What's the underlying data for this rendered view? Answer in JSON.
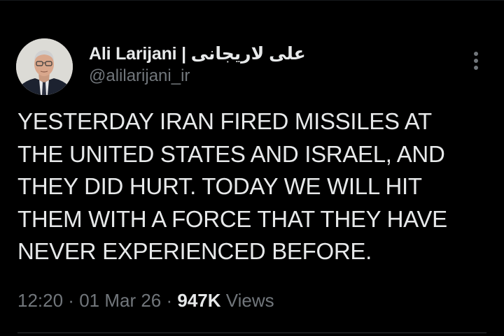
{
  "author": {
    "display_name": "Ali Larijani | علی لاریجانی",
    "handle": "@alilarijani_ir"
  },
  "tweet": {
    "lines": [
      "YESTERDAY IRAN FIRED MISSILES AT",
      "THE UNITED STATES AND ISRAEL, AND",
      "THEY DID HURT. TODAY WE WILL HIT",
      "THEM WITH A FORCE THAT THEY HAVE",
      "NEVER EXPERIENCED BEFORE."
    ]
  },
  "meta": {
    "time": "12:20",
    "separator": " · ",
    "date": "01 Mar 26",
    "views_count": "947K",
    "views_label": " Views"
  },
  "icons": {
    "more": "more-vertical-icon",
    "avatar": "profile-photo"
  },
  "colors": {
    "background": "#000000",
    "text_primary": "#e7e9ea",
    "text_secondary": "#71767b",
    "divider": "#2f3336"
  }
}
